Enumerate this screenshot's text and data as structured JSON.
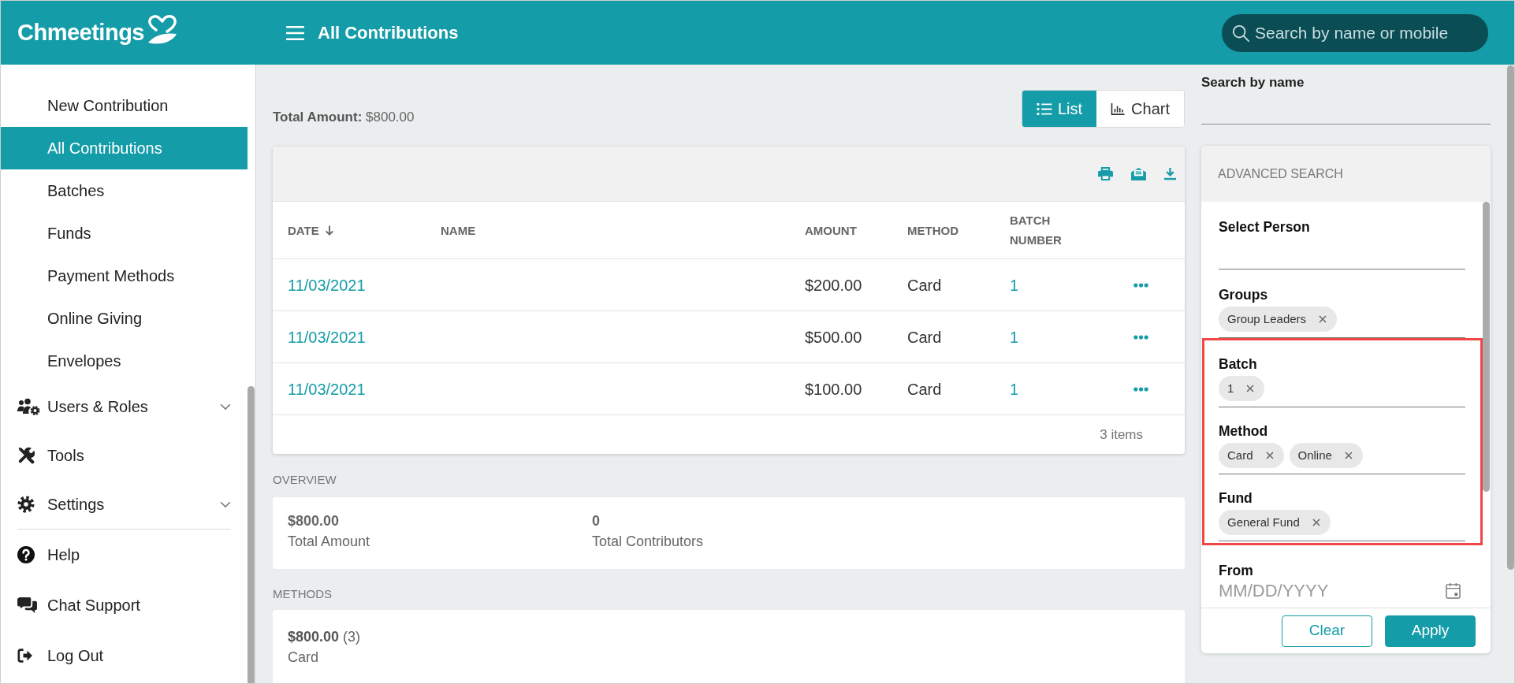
{
  "header": {
    "logo": "Chmeetings",
    "title": "All Contributions",
    "search": {
      "placeholder": "Search by name or mobile"
    }
  },
  "sidebar": {
    "sub_items": [
      {
        "label": "New Contribution",
        "selected": false
      },
      {
        "label": "All Contributions",
        "selected": true
      },
      {
        "label": "Batches",
        "selected": false
      },
      {
        "label": "Funds",
        "selected": false
      },
      {
        "label": "Payment Methods",
        "selected": false
      },
      {
        "label": "Online Giving",
        "selected": false
      },
      {
        "label": "Envelopes",
        "selected": false
      }
    ],
    "sections": [
      {
        "label": "Users & Roles",
        "kind": "group",
        "expanded": false,
        "selected": false
      },
      {
        "label": "Tools",
        "kind": "link",
        "selected": false
      },
      {
        "label": "Settings",
        "kind": "group",
        "expanded": false,
        "selected": false
      }
    ],
    "bottom_items": [
      {
        "label": "Help",
        "selected": false
      },
      {
        "label": "Chat Support",
        "selected": false
      },
      {
        "label": "Log Out",
        "selected": false
      }
    ]
  },
  "summary": {
    "text": "**Total Amount:** $800.00"
  },
  "view_toggle": [
    {
      "label": "List",
      "selected": true
    },
    {
      "label": "Chart",
      "selected": false
    }
  ],
  "table": {
    "columns": [
      {
        "label": "DATE",
        "sorted": true
      },
      {
        "label": "NAME",
        "sorted": false
      },
      {
        "label": "AMOUNT",
        "sorted": false
      },
      {
        "label": "METHOD",
        "sorted": false
      },
      {
        "label": "BATCH NUMBER",
        "sorted": false
      }
    ],
    "rows": [
      {
        "date": "11/03/2021",
        "amount": "$200.00",
        "method": "Card",
        "batch": "1"
      },
      {
        "date": "11/03/2021",
        "amount": "$500.00",
        "method": "Card",
        "batch": "1"
      },
      {
        "date": "11/03/2021",
        "amount": "$100.00",
        "method": "Card",
        "batch": "1"
      }
    ],
    "footer": "3 items"
  },
  "overview": {
    "title": "OVERVIEW",
    "stats": [
      {
        "value": "$800.00",
        "label": "Total Amount"
      },
      {
        "value": "0",
        "label": "Total Contributors"
      }
    ]
  },
  "methods": {
    "title": "METHODS",
    "items": [
      {
        "summary": "**$800.00** (3)",
        "label": "Card"
      }
    ]
  },
  "search_by_name": {
    "label": "Search by name"
  },
  "advanced_search": {
    "title": "ADVANCED SEARCH",
    "filters": [
      {
        "label": "Select Person",
        "kind": "chips",
        "highlighted": false
      },
      {
        "label": "Groups",
        "kind": "chips",
        "chips": [
          "Group Leaders"
        ],
        "highlighted": false
      },
      {
        "label": "Batch",
        "kind": "chips",
        "chips": [
          "1"
        ],
        "highlighted": true
      },
      {
        "label": "Method",
        "kind": "chips",
        "chips": [
          "Card",
          "Online"
        ],
        "highlighted": true
      },
      {
        "label": "Fund",
        "kind": "chips",
        "chips": [
          "General Fund"
        ],
        "highlighted": true
      },
      {
        "label": "From",
        "kind": "date",
        "placeholder": "MM/DD/YYYY",
        "highlighted": false
      }
    ],
    "buttons": [
      {
        "label": "Clear",
        "kind": "outline"
      },
      {
        "label": "Apply",
        "kind": "primary"
      }
    ]
  }
}
